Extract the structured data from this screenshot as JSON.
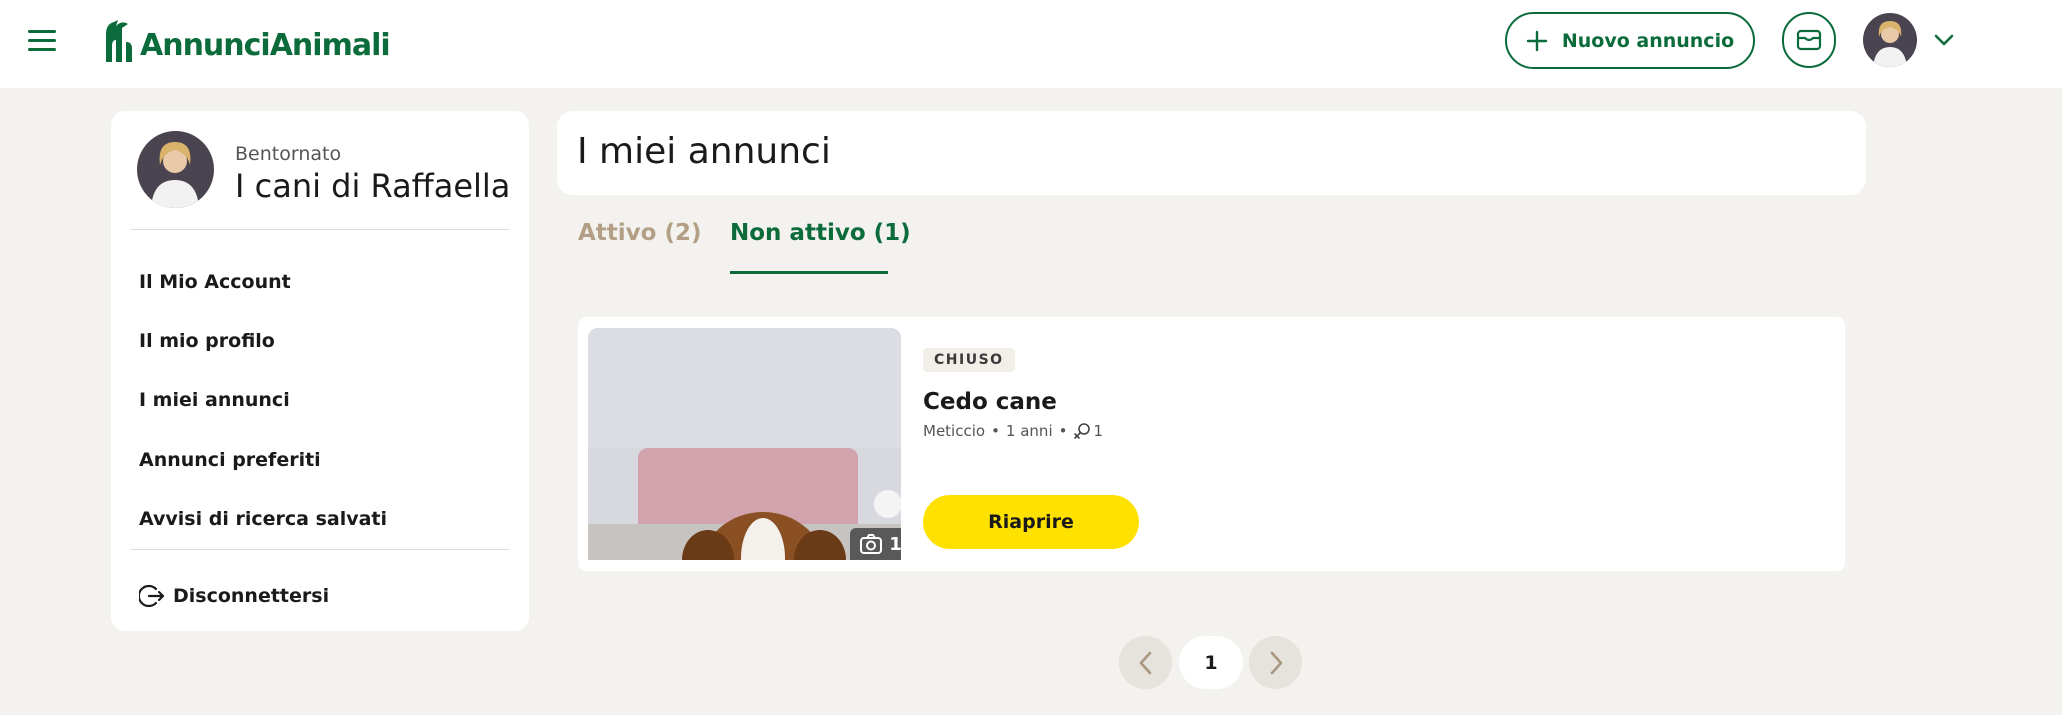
{
  "header": {
    "logo_text": "AnnunciAnimali",
    "new_ad_label": "Nuovo annuncio",
    "icons": {
      "menu": "hamburger-menu-icon",
      "new_ad": "plus-icon",
      "messages": "mail-icon",
      "user_menu": "chevron-down-icon"
    }
  },
  "sidebar": {
    "welcome": "Bentornato",
    "profile_name": "I cani di Raffaella",
    "items": [
      {
        "label": "Il Mio Account"
      },
      {
        "label": "Il mio profilo"
      },
      {
        "label": "I miei annunci"
      },
      {
        "label": "Annunci preferiti"
      },
      {
        "label": "Avvisi di ricerca salvati"
      }
    ],
    "logout_label": "Disconnettersi"
  },
  "main": {
    "title": "I miei annunci",
    "tabs": [
      {
        "label": "Attivo (2)",
        "active": false
      },
      {
        "label": "Non attivo (1)",
        "active": true
      }
    ]
  },
  "listing": {
    "status": "CHIUSO",
    "title": "Cedo cane",
    "breed": "Meticcio",
    "age": "1 anni",
    "sex_count": "1",
    "photo_count": "1",
    "action_label": "Riaprire"
  },
  "pagination": {
    "current_page": "1"
  },
  "colors": {
    "brand_green": "#0b6b3a",
    "accent_yellow": "#ffe100",
    "page_background": "#f3f2ef",
    "inactive_tab": "#b39f85"
  }
}
